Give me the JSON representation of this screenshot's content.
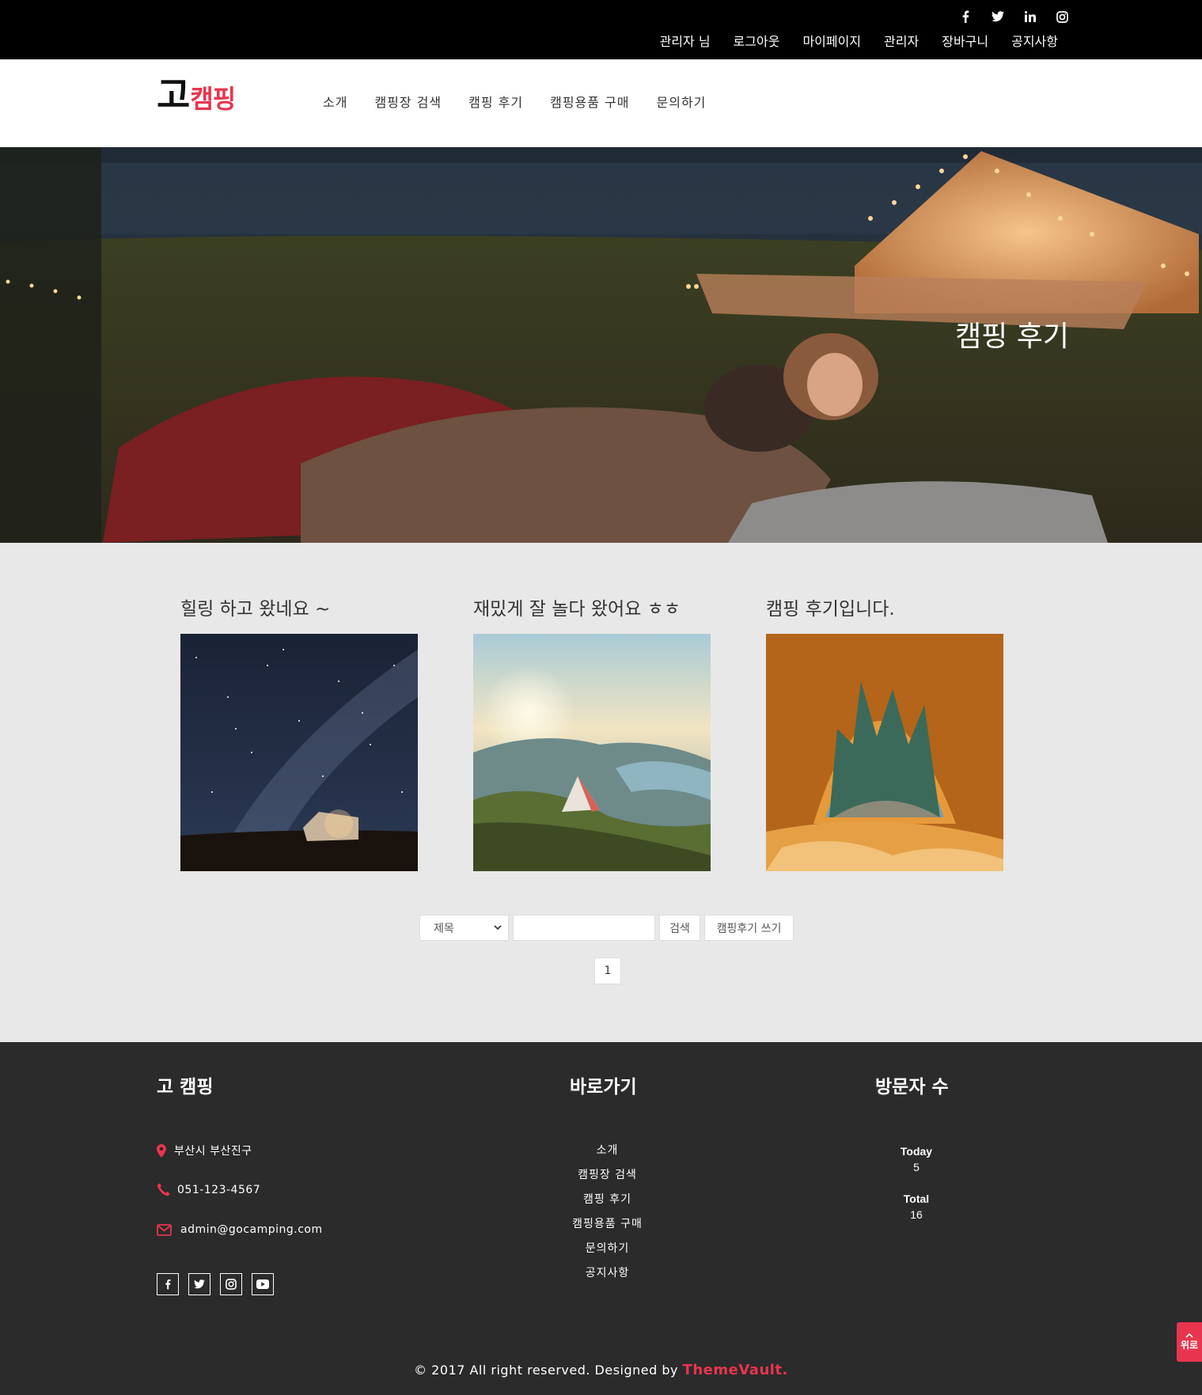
{
  "topbar": {
    "social": [
      {
        "icon": "facebook-icon"
      },
      {
        "icon": "twitter-icon"
      },
      {
        "icon": "linkedin-icon"
      },
      {
        "icon": "instagram-icon"
      }
    ],
    "links": [
      "관리자 님",
      "로그아웃",
      "마이페이지",
      "관리자",
      "장바구니",
      "공지사항"
    ]
  },
  "header": {
    "logo_main": "고",
    "logo_sub": "캠핑",
    "nav": [
      "소개",
      "캠핑장 검색",
      "캠핑 후기",
      "캠핑용품 구매",
      "문의하기"
    ]
  },
  "hero": {
    "title": "캠핑 후기"
  },
  "posts": [
    {
      "title": "힐링 하고 왔네요 ~"
    },
    {
      "title": "재밌게 잘 놀다 왔어요 ㅎㅎ"
    },
    {
      "title": "캠핑 후기입니다."
    }
  ],
  "search": {
    "select_value": "제목",
    "input_value": "",
    "search_label": "검색",
    "write_label": "캠핑후기 쓰기"
  },
  "pagination": {
    "current": "1"
  },
  "footer": {
    "brand_title": "고 캠핑",
    "address": "부산시 부산진구",
    "phone": "051-123-4567",
    "email": "admin@gocamping.com",
    "social": [
      {
        "icon": "facebook-icon"
      },
      {
        "icon": "twitter-icon"
      },
      {
        "icon": "instagram-icon"
      },
      {
        "icon": "youtube-icon"
      }
    ],
    "quick_title": "바로가기",
    "quick_links": [
      "소개",
      "캠핑장 검색",
      "캠핑 후기",
      "캠핑용품 구매",
      "문의하기",
      "공지사항"
    ],
    "visitors_title": "방문자 수",
    "today_label": "Today",
    "today_value": "5",
    "total_label": "Total",
    "total_value": "16",
    "copyright_text": "© 2017 All right reserved. Designed by ",
    "copyright_brand": "ThemeVault."
  },
  "to_top": {
    "label": "위로"
  },
  "colors": {
    "accent": "#e8354f",
    "topbar_bg": "#000000",
    "footer_bg": "#2b2b2b",
    "content_bg": "#e8e8e8"
  }
}
